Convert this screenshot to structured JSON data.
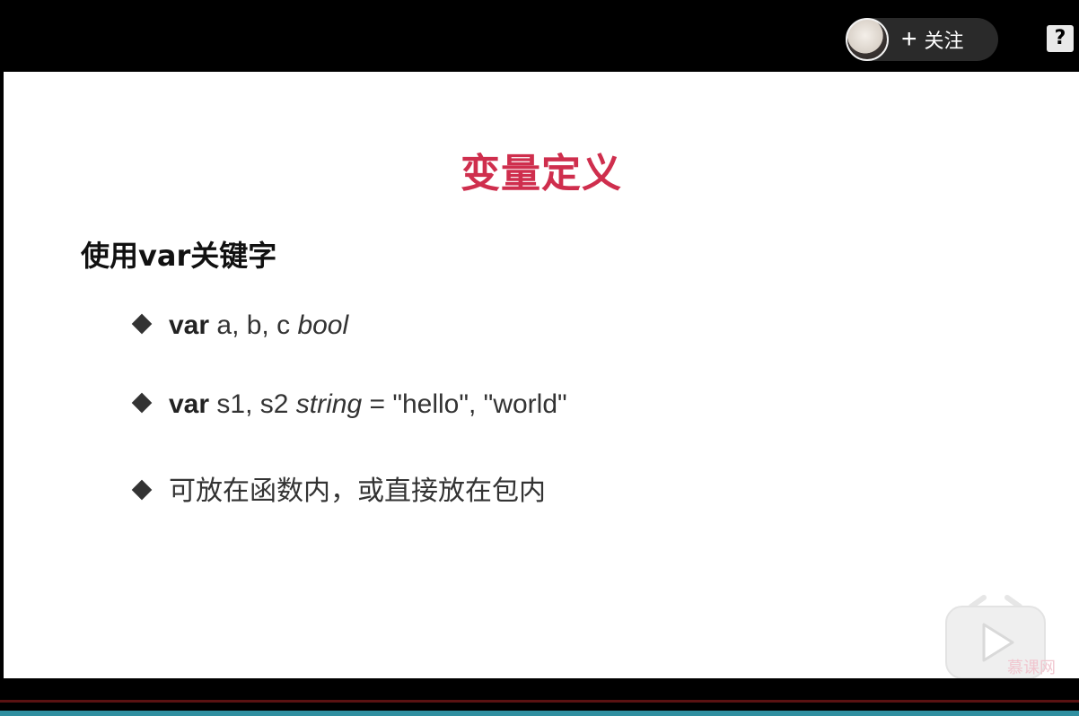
{
  "player": {
    "follow_plus": "+",
    "follow_label": "关注",
    "help_symbol": "?"
  },
  "slide": {
    "title": "变量定义",
    "heading": "使用var关键字",
    "bullets": [
      {
        "kw": "var",
        "text": " a, b, c ",
        "italic": "bool",
        "tail": ""
      },
      {
        "kw": "var",
        "text": " s1, s2 ",
        "italic": "string",
        "tail": " = \"hello\", \"world\""
      },
      {
        "text": "可放在函数内，或直接放在包内"
      }
    ]
  },
  "watermark": {
    "text": "慕课网"
  },
  "colors": {
    "title": "#cf2e4d",
    "text": "#333333",
    "background": "#ffffff",
    "frame": "#000000"
  },
  "icons": [
    "avatar",
    "plus-icon",
    "help-icon",
    "diamond-bullet-icon",
    "play-logo-icon"
  ]
}
